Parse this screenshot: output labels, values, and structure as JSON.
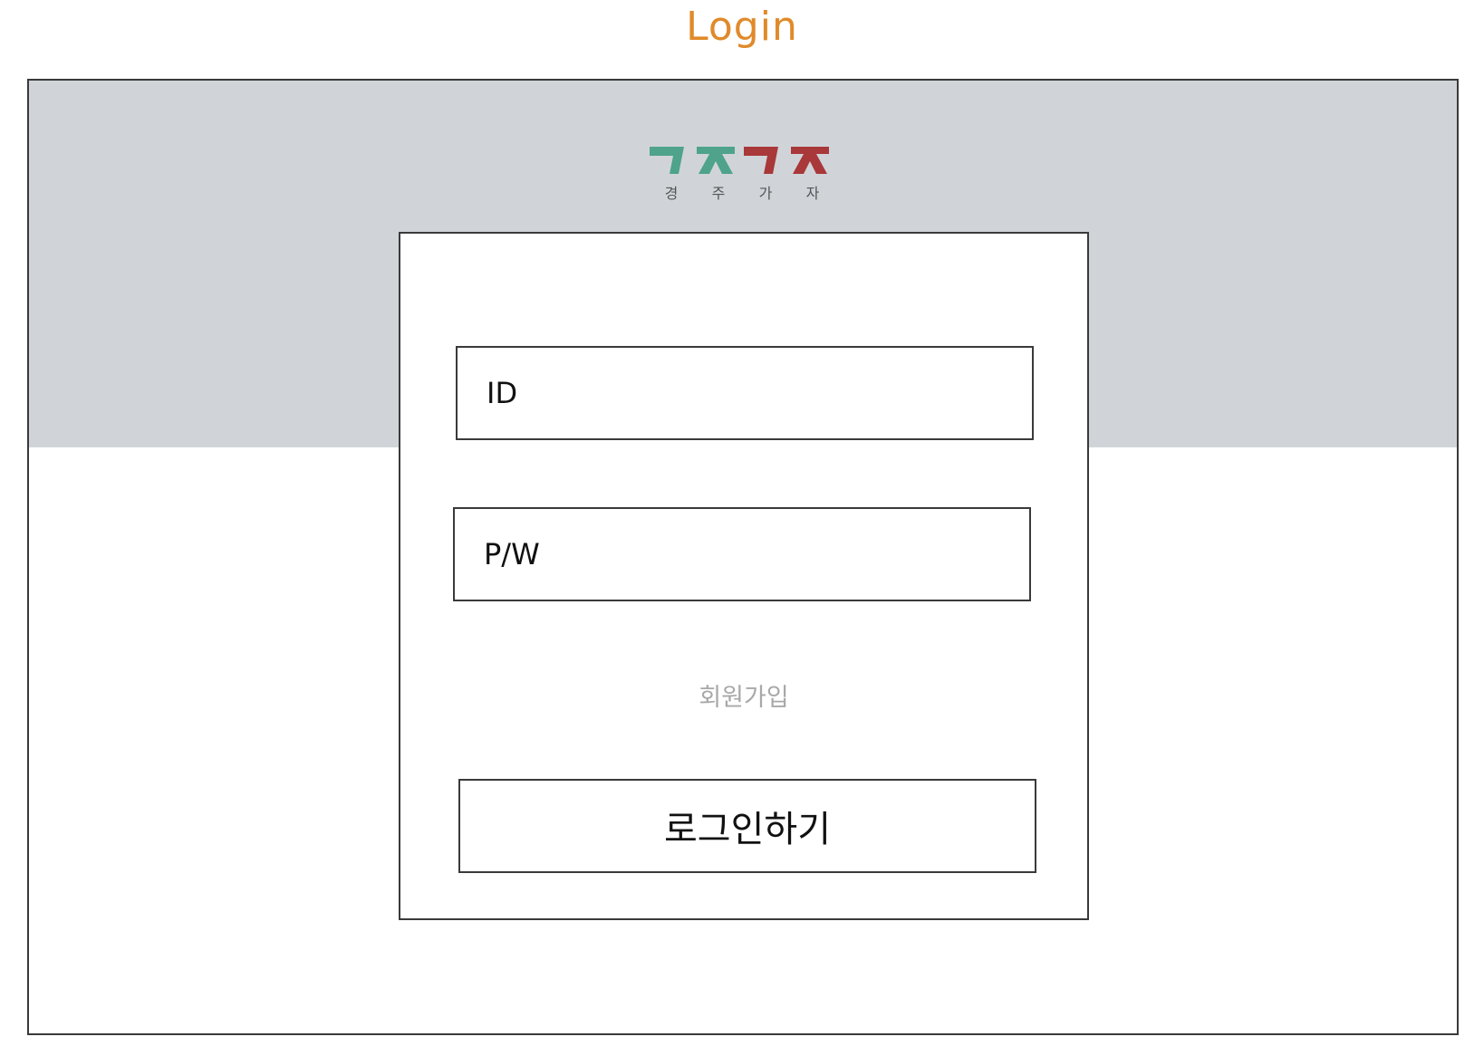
{
  "page": {
    "title": "Login"
  },
  "logo": {
    "letters": [
      "경",
      "주",
      "가",
      "자"
    ],
    "colors": {
      "green": "#4ea38a",
      "red": "#a8383a"
    }
  },
  "form": {
    "id_placeholder": "ID",
    "pw_placeholder": "P/W",
    "signup_label": "회원가입",
    "login_label": "로그인하기"
  },
  "colors": {
    "title": "#e08a2a",
    "header_band": "#d0d4d8",
    "signup_text": "#a8a8a8",
    "border": "#3a3a3a"
  }
}
